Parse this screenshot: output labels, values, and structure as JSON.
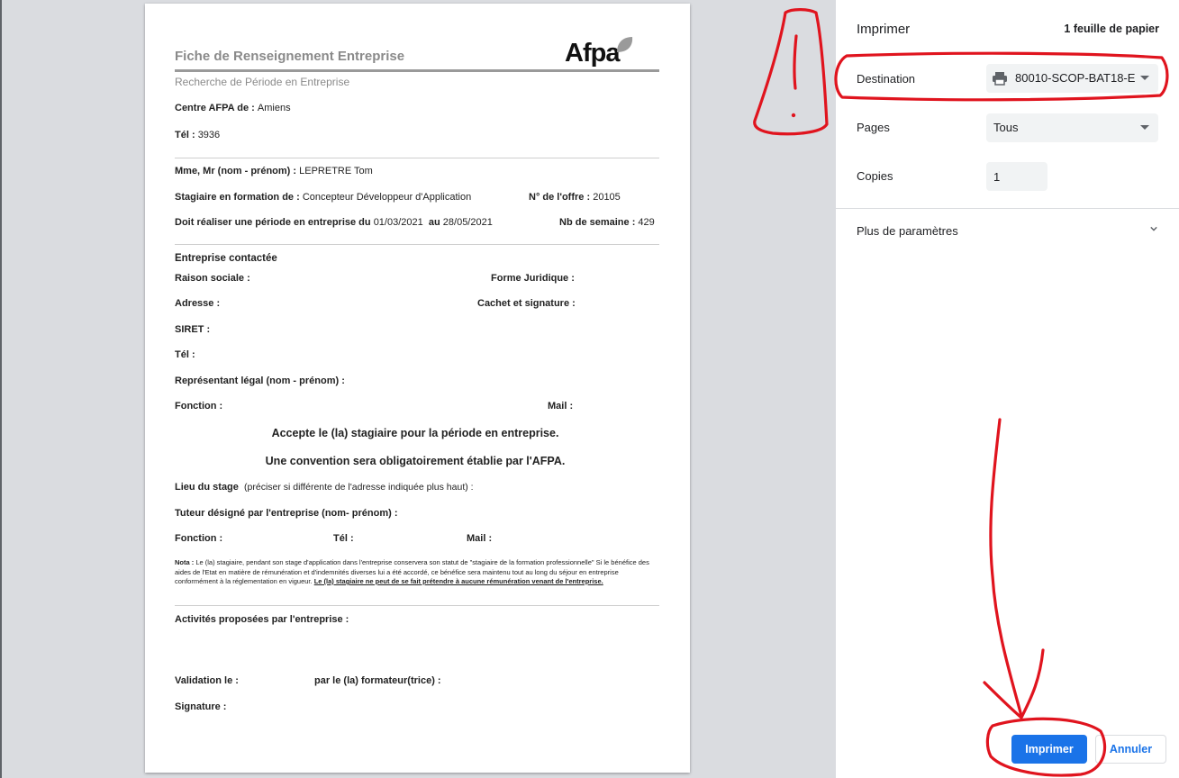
{
  "document": {
    "title": "Fiche de Renseignement Entreprise",
    "subtitle": "Recherche de Période en Entreprise",
    "logo_text": "Afpa",
    "centre_label": "Centre AFPA de :",
    "centre_value": "Amiens",
    "tel_label": "Tél :",
    "tel_value": "3936",
    "name_label": "Mme, Mr (nom - prénom) :",
    "name_value": "LEPRETRE Tom",
    "training_label": "Stagiaire en formation de :",
    "training_value": "Concepteur Développeur d'Application",
    "offer_label": "N° de l'offre :",
    "offer_value": "20105",
    "period_label": "Doit réaliser une période en entreprise du",
    "period_from": "01/03/2021",
    "period_to_label": "au",
    "period_to": "28/05/2021",
    "weeks_label": "Nb de semaine :",
    "weeks_value": "429",
    "company_heading": "Entreprise contactée",
    "raison_sociale": "Raison sociale :",
    "forme_juridique": "Forme Juridique :",
    "adresse": "Adresse :",
    "cachet": "Cachet et signature :",
    "siret": "SIRET :",
    "tel2": "Tél :",
    "representant": "Représentant légal (nom - prénom) :",
    "fonction": "Fonction :",
    "mail": "Mail :",
    "accept": "Accepte le (la) stagiaire pour la période en entreprise.",
    "convention": "Une convention sera obligatoirement établie par l'AFPA.",
    "lieu_label": "Lieu du stage",
    "lieu_hint": "(préciser si différente de l'adresse indiquée plus haut) :",
    "tuteur": "Tuteur désigné par l'entreprise (nom- prénom) :",
    "fonction2": "Fonction :",
    "tel3": "Tél :",
    "mail2": "Mail :",
    "note_label": "Nota :",
    "note_text": "Le (la) stagiaire, pendant son stage d'application dans l'entreprise conservera son statut de \"stagiaire de la formation professionnelle\" Si le bénéfice des aides de l'Etat en matière de rémunération et d'indemnités diverses lui a été accordé, ce bénéfice sera maintenu tout au long du séjour en entreprise conformément à la réglementation en vigueur.",
    "note_emphasis": "Le (la) stagiaire ne peut de se fait prétendre à aucune rémunération venant de l'entreprise.",
    "activites": "Activités proposées par l'entreprise :",
    "validation": "Validation le :",
    "par_formateur": "par le (la) formateur(trice) :",
    "signature": "Signature :"
  },
  "print_panel": {
    "title": "Imprimer",
    "sheet_count": "1 feuille de papier",
    "destination_label": "Destination",
    "destination_value": "80010-SCOP-BAT18-E",
    "pages_label": "Pages",
    "pages_value": "Tous",
    "copies_label": "Copies",
    "copies_value": "1",
    "more_settings": "Plus de paramètres",
    "print_button": "Imprimer",
    "cancel_button": "Annuler"
  },
  "colors": {
    "accent": "#1a73e8",
    "annotation": "#e0141e",
    "preview_bg": "#dadce0"
  }
}
